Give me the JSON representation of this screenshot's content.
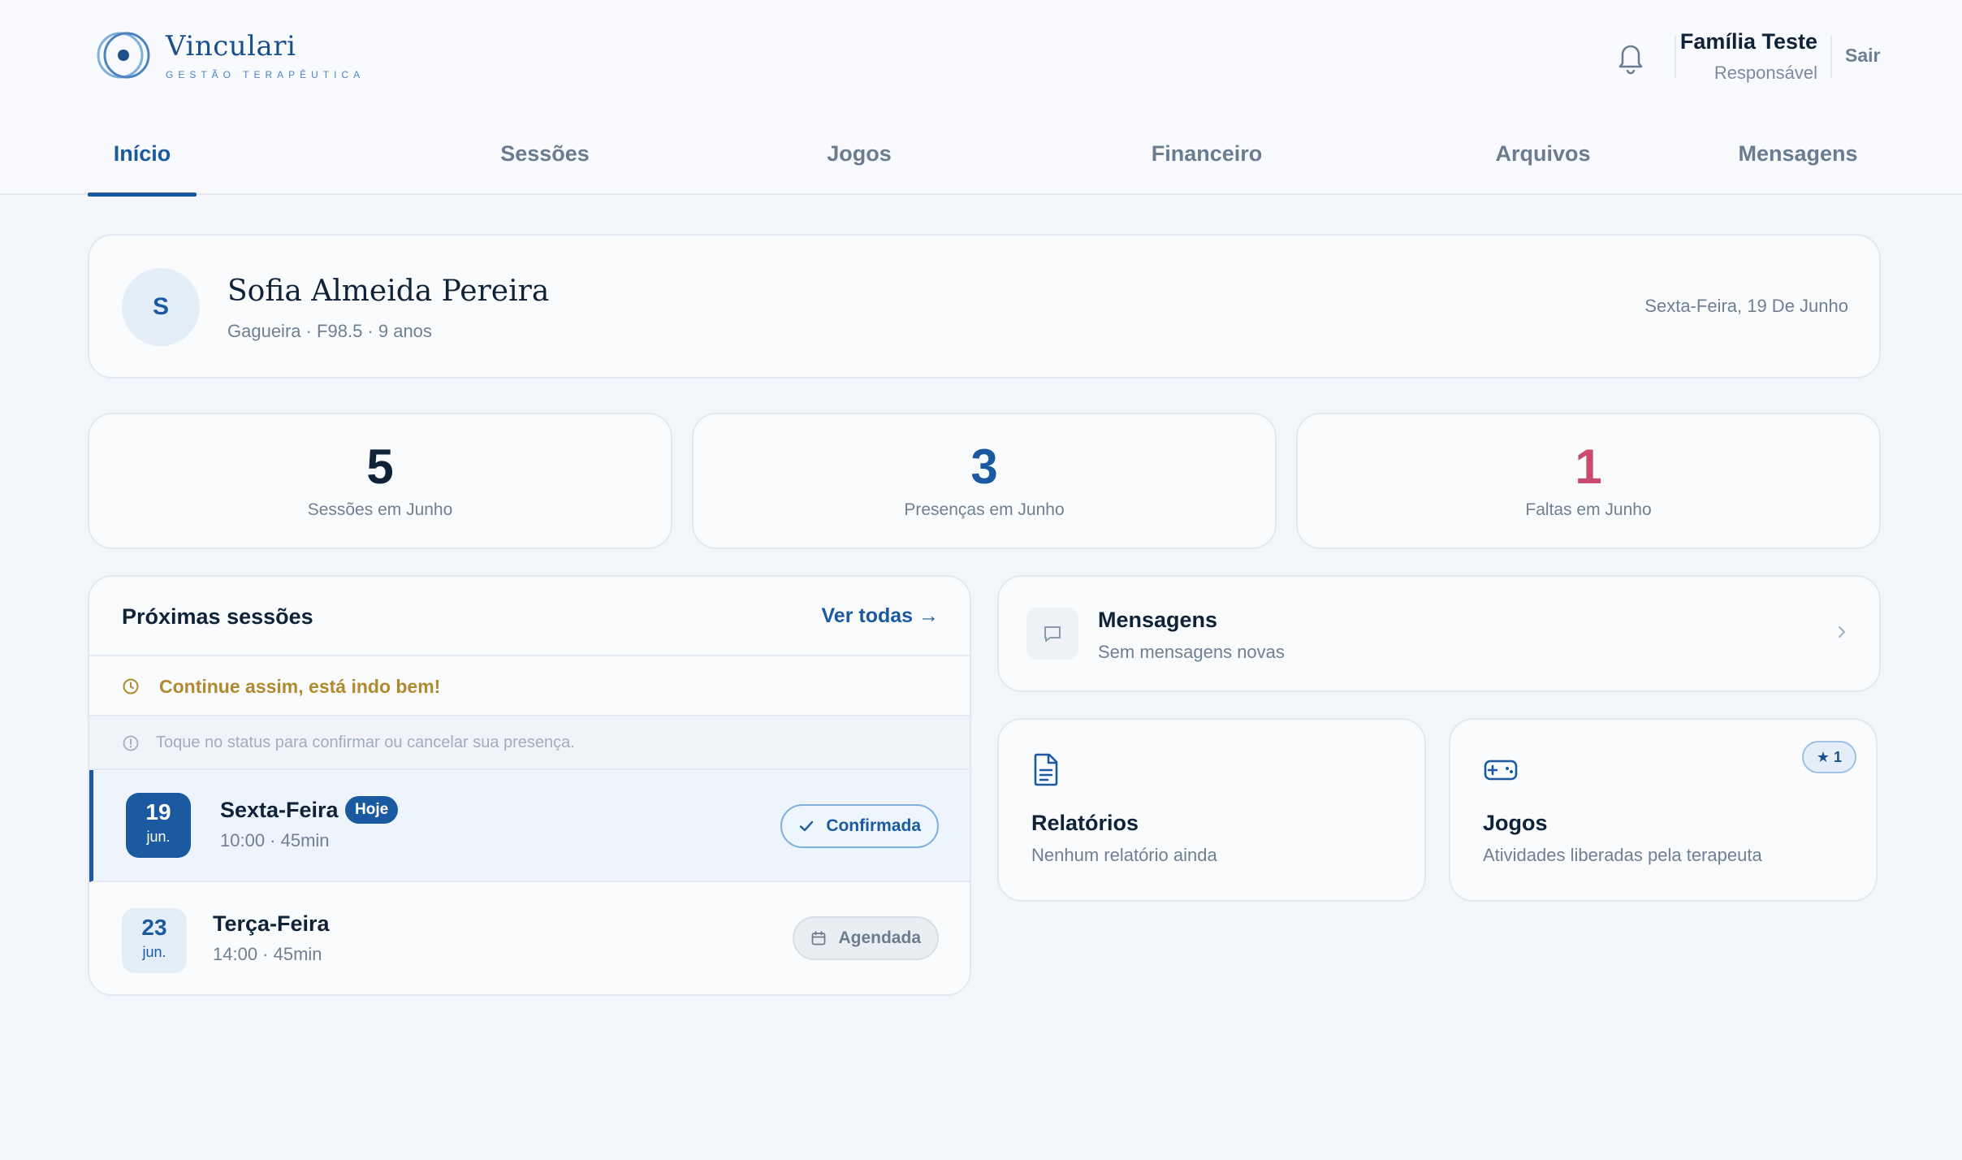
{
  "brand": {
    "name": "Vinculari",
    "tagline": "GESTÃO TERAPÊUTICA"
  },
  "user": {
    "name": "Família Teste",
    "role": "Responsável",
    "logout": "Sair"
  },
  "tabs": [
    {
      "label": "Início",
      "active": true
    },
    {
      "label": "Sessões"
    },
    {
      "label": "Jogos"
    },
    {
      "label": "Financeiro"
    },
    {
      "label": "Arquivos"
    },
    {
      "label": "Mensagens"
    }
  ],
  "patient": {
    "initial": "S",
    "name": "Sofia Almeida Pereira",
    "meta": "Gagueira · F98.5 · 9 anos",
    "date": "Sexta-Feira, 19 De Junho"
  },
  "stats": [
    {
      "value": "5",
      "label": "Sessões em Junho",
      "color": "#0f2238"
    },
    {
      "value": "3",
      "label": "Presenças em Junho",
      "color": "#1b5aa0"
    },
    {
      "value": "1",
      "label": "Faltas em Junho",
      "color": "#c94b6e"
    }
  ],
  "sessions": {
    "title": "Próximas sessões",
    "view_all": "Ver todas →",
    "banner": "Continue assim, está indo bem!",
    "hint": "Toque no status para confirmar ou cancelar sua presença.",
    "items": [
      {
        "day": "19",
        "month": "jun.",
        "weekday": "Sexta-Feira",
        "time": "10:00 · 45min",
        "badge": "Hoje",
        "status": "Confirmada"
      },
      {
        "day": "23",
        "month": "jun.",
        "weekday": "Terça-Feira",
        "time": "14:00 · 45min",
        "status": "Agendada"
      }
    ]
  },
  "messages": {
    "title": "Mensagens",
    "subtitle": "Sem mensagens novas"
  },
  "reports": {
    "title": "Relatórios",
    "subtitle": "Nenhum relatório ainda"
  },
  "games": {
    "title": "Jogos",
    "subtitle": "Atividades liberadas pela terapeuta",
    "badge": "★ 1"
  },
  "colors": {
    "primary": "#1b5aa0",
    "danger": "#c94b6e",
    "warning": "#b08a2e"
  },
  "icons": [
    "logo-icon",
    "bell-icon",
    "clock-icon",
    "info-icon",
    "check-icon",
    "calendar-icon",
    "chat-icon",
    "chevron-right-icon",
    "document-icon",
    "gamepad-icon"
  ]
}
